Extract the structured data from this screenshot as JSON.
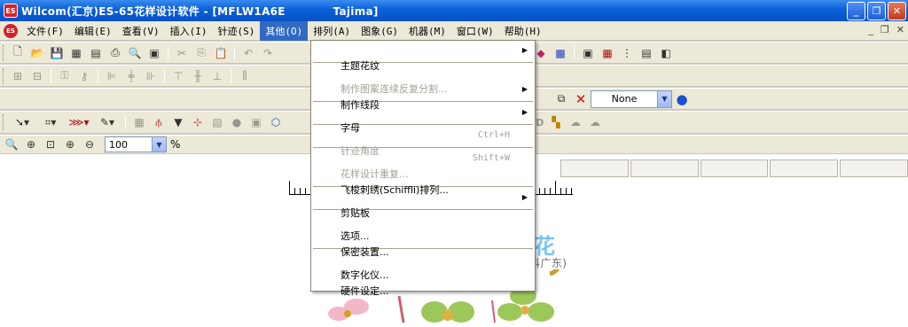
{
  "window": {
    "logo": "ES",
    "title": "Wilcom(汇京)ES-65花样设计软件 - [MFLW1A6E            Tajima]",
    "minimize": "_",
    "restore": "❐",
    "close": "✕"
  },
  "menubar": {
    "items": [
      {
        "label": "文件(F)"
      },
      {
        "label": "编辑(E)"
      },
      {
        "label": "查看(V)"
      },
      {
        "label": "插入(I)"
      },
      {
        "label": "针迹(S)"
      },
      {
        "label": "其他(O)"
      },
      {
        "label": "排列(A)"
      },
      {
        "label": "图象(G)"
      },
      {
        "label": "机器(M)"
      },
      {
        "label": "窗口(W)"
      },
      {
        "label": "帮助(H)"
      }
    ],
    "mdi_minimize": "_",
    "mdi_restore": "❐",
    "mdi_close": "✕"
  },
  "toolbar": {
    "color_combo_value": "None",
    "zoom_value": "100",
    "zoom_unit": "%"
  },
  "dropdown": {
    "items": [
      {
        "label": "主题花纹",
        "submenu": true,
        "enabled": true
      },
      {
        "label": "制作图案连续反复分割...",
        "enabled": false
      },
      {
        "label": "制作线段",
        "submenu": true,
        "enabled": true
      },
      {
        "label": "字母",
        "submenu": true,
        "enabled": true
      },
      {
        "label": "针迹角度",
        "shortcut": "Ctrl+H",
        "enabled": false
      },
      {
        "label": "花样设计重复...",
        "shortcut": "Shift+W",
        "enabled": false
      },
      {
        "label": "飞梭刺绣(Schiffli)排列...",
        "enabled": true
      },
      {
        "label": "剪贴板",
        "submenu": true,
        "enabled": true
      },
      {
        "label": "选项...",
        "enabled": true
      },
      {
        "label": "保密装置...",
        "enabled": true
      },
      {
        "label": "数字化仪...",
        "enabled": true
      },
      {
        "label": "硬件设定...",
        "enabled": true
      }
    ],
    "submenu_arrow": "▶"
  },
  "watermark": {
    "text": "联科绣花",
    "url": "LINKGD.COM(联科广东)"
  },
  "colors": {
    "titlebar": "#0a5fd8",
    "menu_highlight": "#316ac5",
    "watermark": "#53b8ee"
  }
}
